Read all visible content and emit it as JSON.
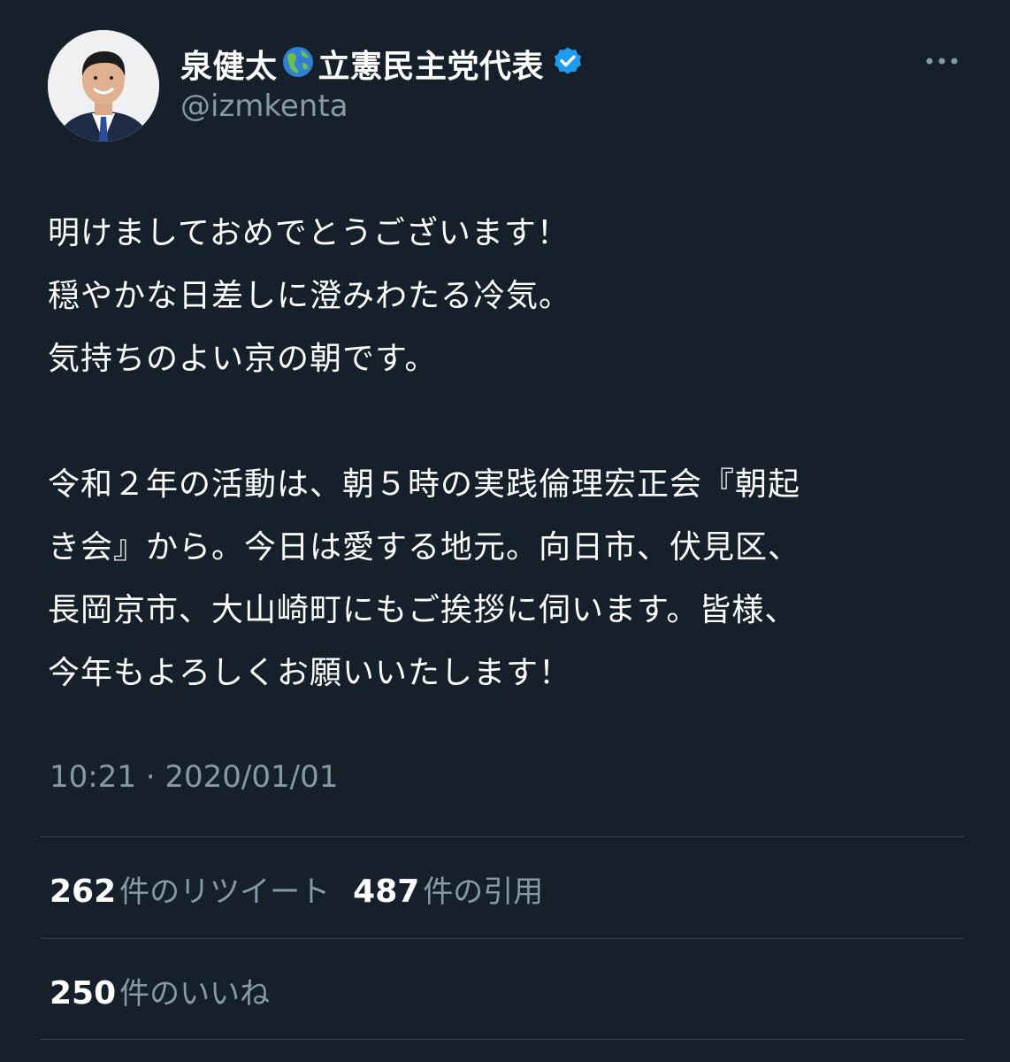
{
  "author": {
    "display_name_part1": "泉健太",
    "display_name_part2": "立憲民主党代表",
    "handle": "@izmkenta"
  },
  "icons": {
    "globe": "globe-americas-emoji-icon",
    "verified": "verified-badge-icon",
    "more": "more-horizontal-icon"
  },
  "colors": {
    "background": "#15202b",
    "text": "#ffffff",
    "secondary_text": "#8899a6",
    "divider": "#38444d",
    "verified_blue": "#1d9bf0"
  },
  "tweet": {
    "lines": [
      "明けましておめでとうございます！",
      "穏やかな日差しに澄みわたる冷気。",
      "気持ちのよい京の朝です。",
      "",
      "令和２年の活動は、朝５時の実践倫理宏正会『朝起",
      "き会』から。今日は愛する地元。向日市、伏見区、",
      "長岡京市、大山崎町にもご挨拶に伺います。皆様、",
      "今年もよろしくお願いいたします！"
    ],
    "timestamp": "10:21 · 2020/01/01"
  },
  "stats": {
    "retweets_count": "262",
    "retweets_label": "件のリツイート",
    "quotes_count": "487",
    "quotes_label": "件の引用",
    "likes_count": "250",
    "likes_label": "件のいいね"
  }
}
